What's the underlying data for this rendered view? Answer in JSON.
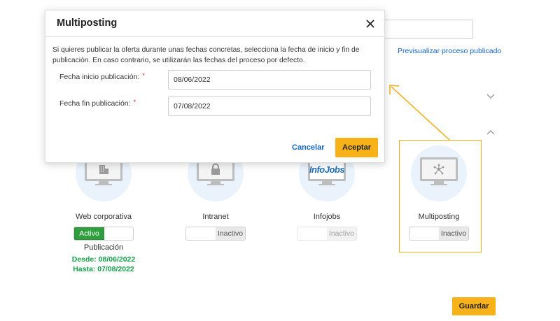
{
  "page": {
    "preview_link": "Previsualizar proceso publicado",
    "save_label": "Guardar",
    "accent_color": "#f7b21a",
    "link_color": "#1665c1",
    "active_color": "#2f9e3c"
  },
  "channels": [
    {
      "name": "Web corporativa",
      "icon": "building-icon",
      "toggle_on": "Activo",
      "state": "active",
      "publication_label": "Publicación",
      "from": "Desde: 08/06/2022",
      "to": "Hasta: 07/08/2022"
    },
    {
      "name": "Intranet",
      "icon": "lock-icon",
      "toggle_off": "Inactivo",
      "state": "inactive"
    },
    {
      "name": "Infojobs",
      "icon": "infojobs-logo",
      "logo_text": "InfoJobs",
      "toggle_off": "Inactivo",
      "state": "disabled"
    },
    {
      "name": "Multiposting",
      "icon": "network-icon",
      "toggle_off": "Inactivo",
      "state": "inactive",
      "highlighted": true
    }
  ],
  "modal": {
    "title": "Multiposting",
    "description": "Si quieres publicar la oferta durante unas fechas concretas, selecciona la fecha de inicio y fin de publicación. En caso contrario, se utilizarán las fechas del proceso por defecto.",
    "start_label": "Fecha inicio publicación:",
    "start_value": "08/06/2022",
    "end_label": "Fecha fin publicación:",
    "end_value": "07/08/2022",
    "required_mark": "*",
    "cancel_label": "Cancelar",
    "accept_label": "Aceptar"
  }
}
